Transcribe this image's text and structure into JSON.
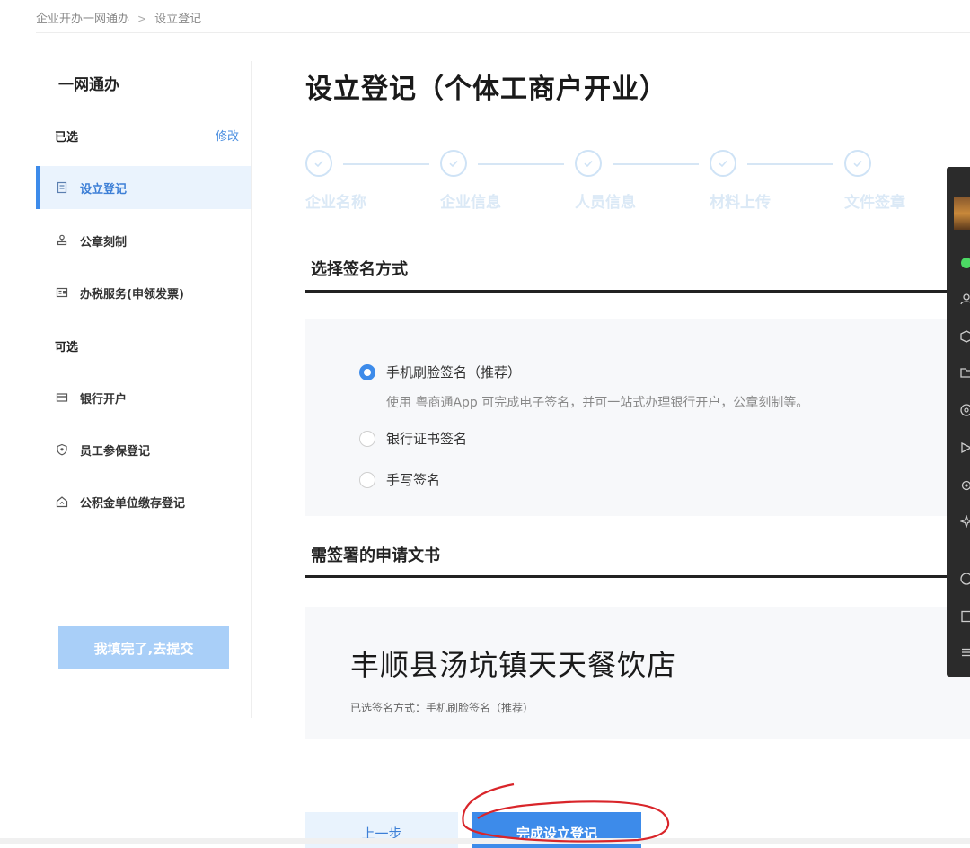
{
  "breadcrumb": {
    "items": [
      "企业开办一网通办",
      "设立登记"
    ],
    "separator": ">"
  },
  "sidebar": {
    "title": "一网通办",
    "required_label": "已选",
    "edit_label": "修改",
    "required_items": [
      {
        "label": "设立登记",
        "icon": "document-icon",
        "active": true
      },
      {
        "label": "公章刻制",
        "icon": "stamp-icon",
        "active": false
      },
      {
        "label": "办税服务(申领发票)",
        "icon": "tax-card-icon",
        "active": false
      }
    ],
    "optional_label": "可选",
    "optional_items": [
      {
        "label": "银行开户",
        "icon": "bank-card-icon"
      },
      {
        "label": "员工参保登记",
        "icon": "shield-icon"
      },
      {
        "label": "公积金单位缴存登记",
        "icon": "house-icon"
      }
    ],
    "submit_label": "我填完了,去提交"
  },
  "main": {
    "title": "设立登记（个体工商户开业）",
    "steps": [
      "企业名称",
      "企业信息",
      "人员信息",
      "材料上传",
      "文件签章"
    ],
    "signature_section": {
      "title": "选择签名方式",
      "options": [
        {
          "label": "手机刷脸签名（推荐）",
          "checked": true
        },
        {
          "label": "银行证书签名",
          "checked": false
        },
        {
          "label": "手写签名",
          "checked": false
        }
      ],
      "recommend_desc": "使用 粤商通App 可完成电子签名，并可一站式办理银行开户，公章刻制等。"
    },
    "documents_section": {
      "title": "需签署的申请文书",
      "company_name": "丰顺县汤坑镇天天餐饮店",
      "selected_method": "已选签名方式：手机刷脸签名（推荐）"
    },
    "prev_label": "上一步",
    "finish_label": "完成设立登记"
  },
  "colors": {
    "accent": "#3d8bea",
    "active_bg": "#eaf3fd",
    "submit_disabled": "#a9cff8",
    "annotation": "#d9252a"
  }
}
